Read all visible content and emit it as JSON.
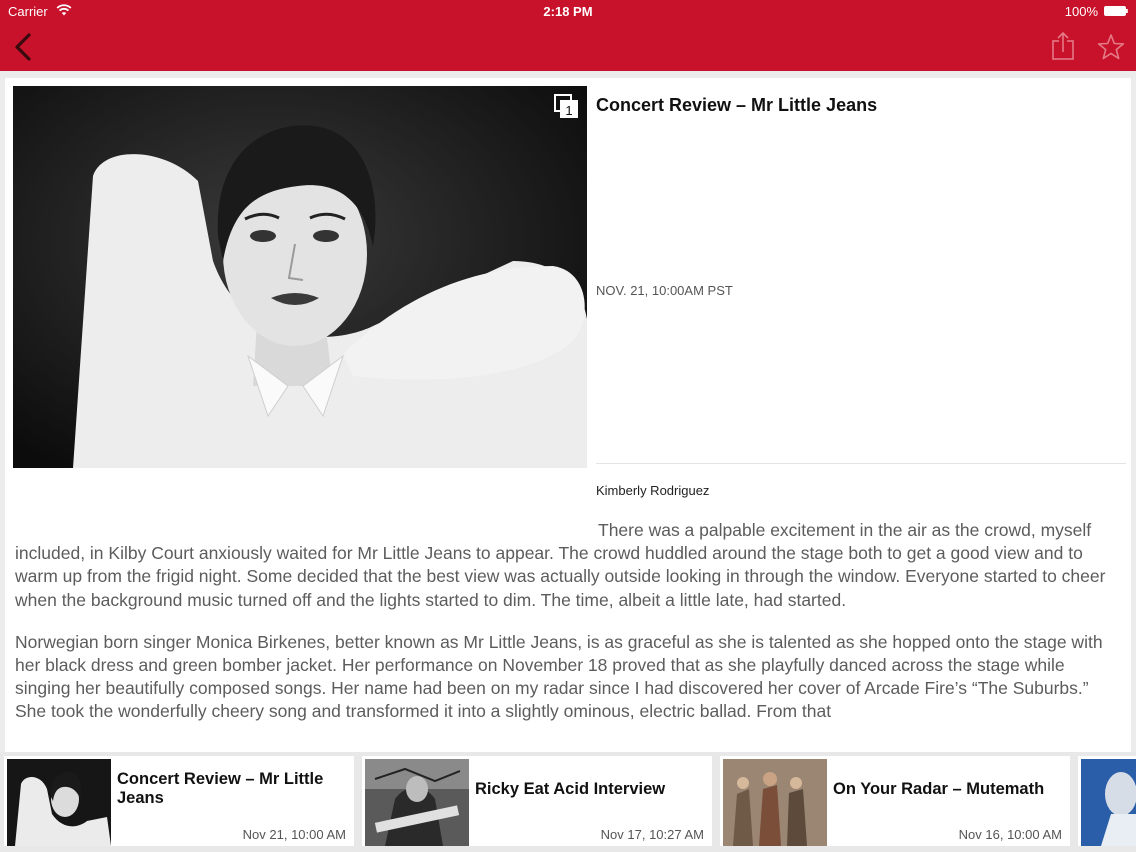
{
  "status_bar": {
    "carrier": "Carrier",
    "time": "2:18 PM",
    "battery": "100%"
  },
  "nav": {
    "back_icon": "chevron-left-icon",
    "share_icon": "share-icon",
    "favorite_icon": "star-icon",
    "bar_color": "#c8112a"
  },
  "article": {
    "gallery_count": "1",
    "title": "Concert Review – Mr Little Jeans",
    "date": "NOV. 21, 10:00AM PST",
    "author": "Kimberly Rodriguez",
    "paragraphs": [
      "There was a palpable excitement in the air as the crowd, myself included, in Kilby Court anxiously waited for Mr Little Jeans to appear. The crowd huddled around the stage both to get a good view and to warm up from the frigid night. Some decided that the best view was actually outside looking in through the window. Everyone started to cheer when the background music turned off and the lights started to dim. The time, albeit a little late, had started.",
      "Norwegian born singer Monica Birkenes, better known as Mr Little Jeans, is as graceful as she is talented as she hopped onto the stage with her black dress and green bomber jacket. Her performance on November 18 proved that as she playfully danced across the stage while singing her beautifully composed songs. Her name had been on my radar since I had discovered her cover of Arcade Fire’s “The Suburbs.” She took the wonderfully cheery song and transformed it into a slightly ominous, electric ballad. From that"
    ]
  },
  "related": [
    {
      "title": "Concert Review – Mr Little Jeans",
      "date": "Nov 21, 10:00 AM"
    },
    {
      "title": "Ricky Eat Acid Interview",
      "date": "Nov 17, 10:27 AM"
    },
    {
      "title": "On Your Radar – Mutemath",
      "date": "Nov 16, 10:00 AM"
    }
  ]
}
